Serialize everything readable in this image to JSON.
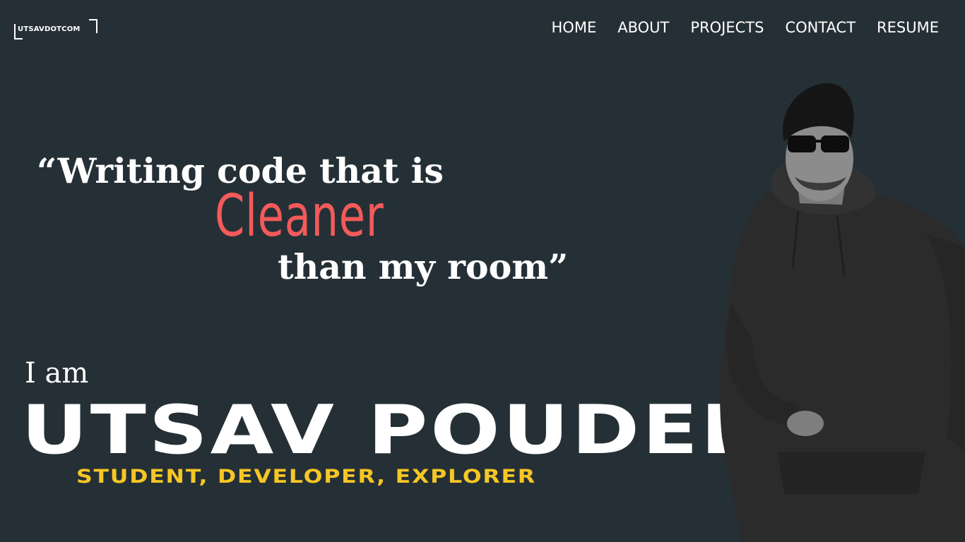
{
  "logo": {
    "text": "UTSAVDOTCOM"
  },
  "nav": {
    "home": "HOME",
    "about": "ABOUT",
    "projects": "PROJECTS",
    "contact": "CONTACT",
    "resume": "RESUME"
  },
  "hero": {
    "quote_line1": "“Writing code that is",
    "quote_accent": "Cleaner",
    "quote_line3": "than my room”",
    "intro": "I am",
    "name": "UTSAV POUDEL",
    "tagline": "STUDENT, DEVELOPER, EXPLORER"
  },
  "colors": {
    "background": "#253036",
    "accent_red": "#f45a5a",
    "accent_yellow": "#f6c625",
    "text": "#ffffff"
  }
}
